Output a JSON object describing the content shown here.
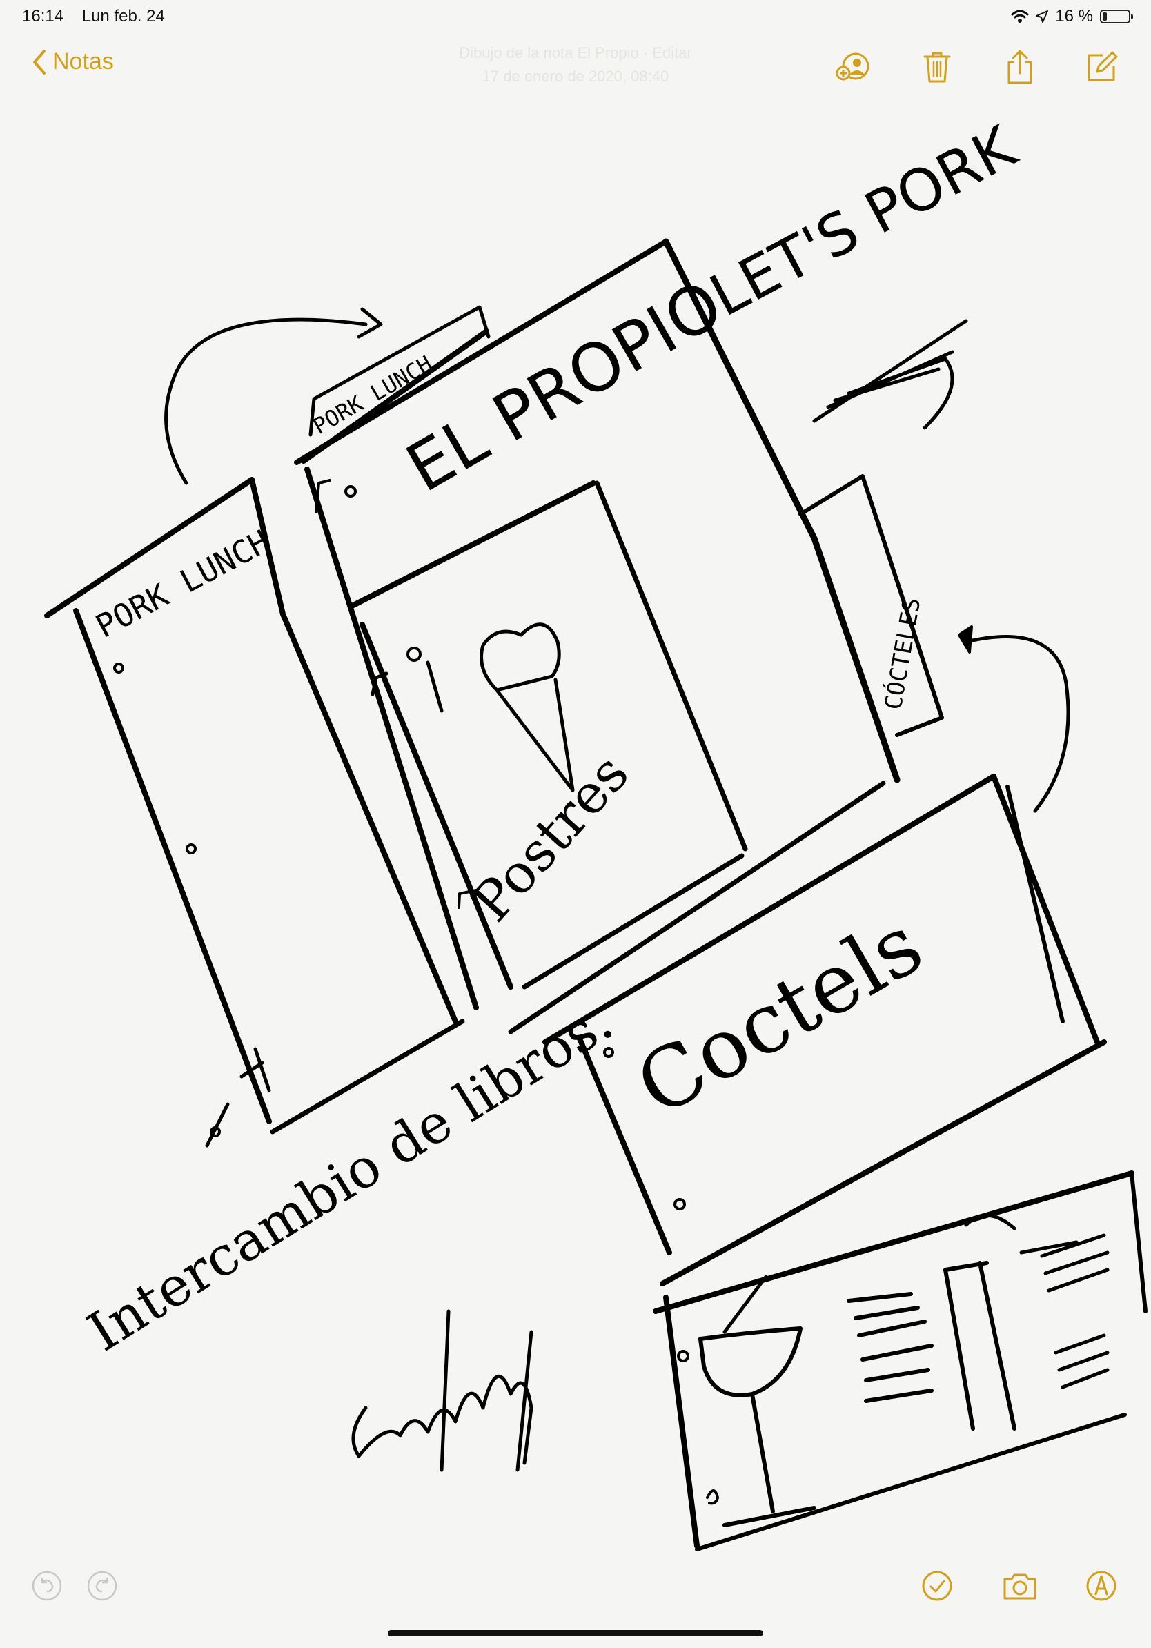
{
  "status_bar": {
    "time": "16:14",
    "date": "Lun feb. 24",
    "battery": "16 %",
    "battery_level": 0.16
  },
  "nav": {
    "back_label": "Notas",
    "note_title": "Dibujo de la nota El Propio · Editar",
    "note_subtitle": "17 de enero de 2020, 08:40",
    "accent_color": "#d4a017"
  },
  "toolbar_icons": [
    "add-person-icon",
    "trash-icon",
    "share-icon",
    "compose-icon"
  ],
  "bottom_icons": [
    "undo-icon",
    "redo-icon",
    "checklist-icon",
    "camera-icon",
    "markup-icon"
  ],
  "sketch": {
    "page_1_label": "PORK LUNCH",
    "tab_label": "PORK LUNCH",
    "main_title": "EL PROPIO",
    "page_3_label": "Postres",
    "side_tab_label": "CÓCTELES",
    "lets_pork": "LET'S PORK",
    "cocktails_label": "Coctels",
    "handwritten_note": "Intercambio de libros."
  }
}
